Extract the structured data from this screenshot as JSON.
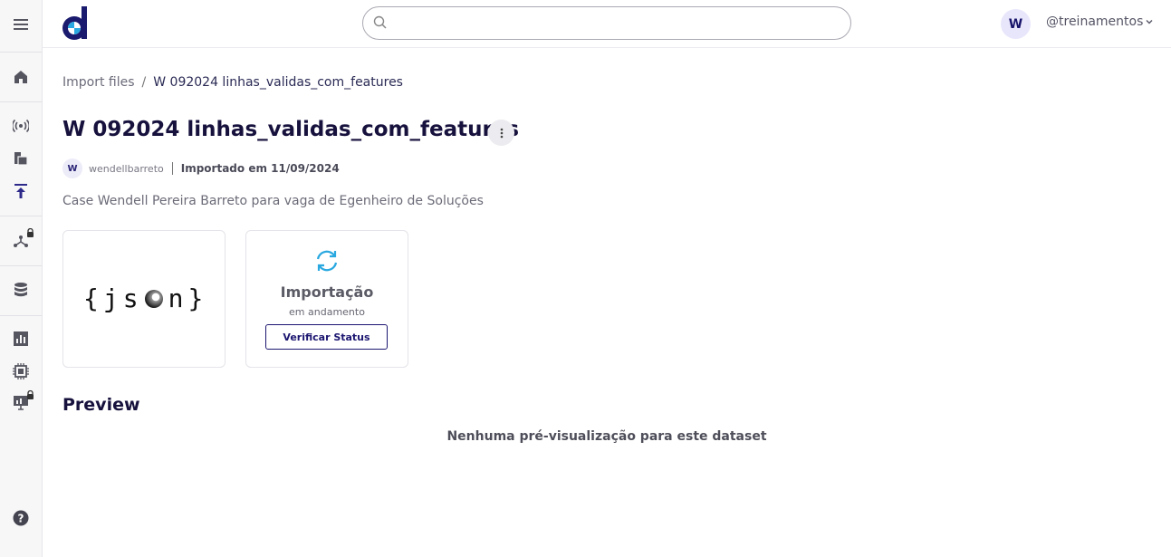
{
  "header": {
    "logo": "datarisk-logo",
    "search": {
      "placeholder": "",
      "value": ""
    },
    "avatar_initial": "W",
    "username": "@treinamentos"
  },
  "sidebar": {
    "items": [
      {
        "name": "menu",
        "icon": "hamburger-menu-icon",
        "locked": false
      },
      {
        "name": "home",
        "icon": "home-icon",
        "locked": false
      },
      {
        "name": "streaming",
        "icon": "broadcast-icon",
        "locked": false
      },
      {
        "name": "files",
        "icon": "documents-icon",
        "locked": false
      },
      {
        "name": "import",
        "icon": "upload-icon",
        "locked": false,
        "active": true
      },
      {
        "name": "pipelines",
        "icon": "graph-nodes-icon",
        "locked": true
      },
      {
        "name": "databases",
        "icon": "database-icon",
        "locked": false
      },
      {
        "name": "dashboards",
        "icon": "bar-chart-icon",
        "locked": false
      },
      {
        "name": "models",
        "icon": "chip-icon",
        "locked": false
      },
      {
        "name": "reports",
        "icon": "presentation-icon",
        "locked": true
      },
      {
        "name": "help",
        "icon": "help-icon",
        "locked": false
      }
    ],
    "colors": {
      "active": "#2d2a8a",
      "default": "#555560"
    }
  },
  "breadcrumb": {
    "parent": "Import files",
    "separator": "/",
    "current": "W 092024 linhas_validas_com_features"
  },
  "dataset": {
    "title": "W 092024 linhas_validas_com_features",
    "author_initial": "W",
    "author": "wendellbarreto",
    "imported_label": "Importado em 11/09/2024",
    "description": "Case Wendell Pereira Barreto para vaga de Egenheiro de Soluções"
  },
  "format_card": {
    "left": "{",
    "j": "j",
    "s": "s",
    "n": "n",
    "right": "}"
  },
  "status_card": {
    "icon": "sync-icon",
    "title": "Importação",
    "subtitle": "em andamento",
    "button_label": "Verificar Status"
  },
  "preview": {
    "title": "Preview",
    "empty_message": "Nenhuma pré-visualização para este dataset"
  },
  "colors": {
    "brand": "#1a1a6e",
    "accent": "#2aa8e0",
    "text_dark": "#17123d"
  }
}
